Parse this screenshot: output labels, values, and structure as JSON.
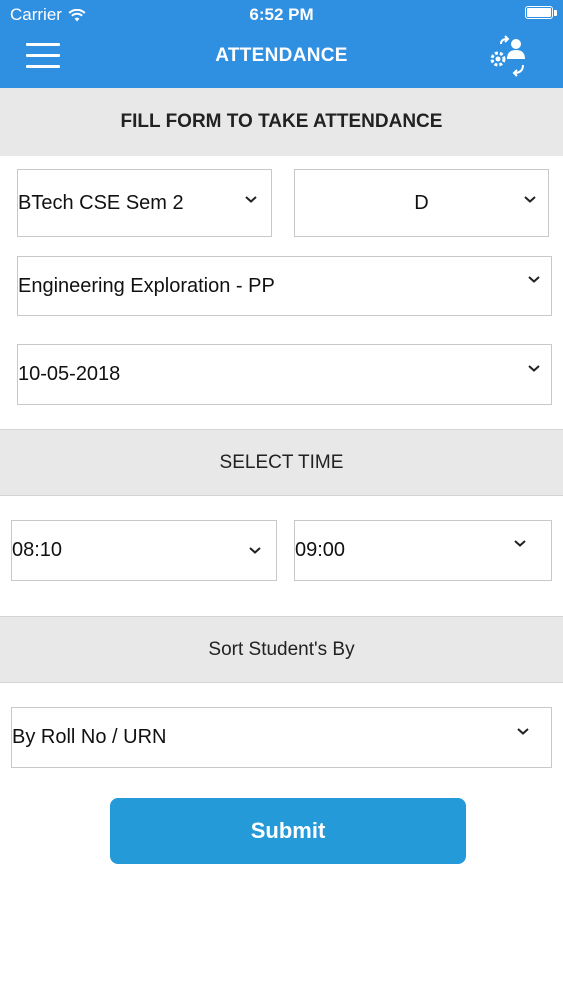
{
  "status": {
    "carrier": "Carrier",
    "time": "6:52 PM"
  },
  "nav": {
    "title": "ATTENDANCE",
    "color": "#2f8fe0"
  },
  "form": {
    "header": "FILL FORM TO TAKE ATTENDANCE",
    "course": "BTech CSE Sem 2",
    "section": "D",
    "subject": "Engineering Exploration - PP",
    "date": "10-05-2018"
  },
  "time": {
    "header": "SELECT TIME",
    "start": "08:10",
    "end": "09:00"
  },
  "sort": {
    "header": "Sort Student's By",
    "value": "By Roll No / URN"
  },
  "submit_label": "Submit",
  "colors": {
    "accent": "#2f8fe0",
    "button": "#259ad8",
    "section_bg": "#e8e8e8"
  },
  "icons": [
    "wifi-icon",
    "battery-icon",
    "menu-icon",
    "user-switch-icon",
    "chevron-down-icon"
  ]
}
